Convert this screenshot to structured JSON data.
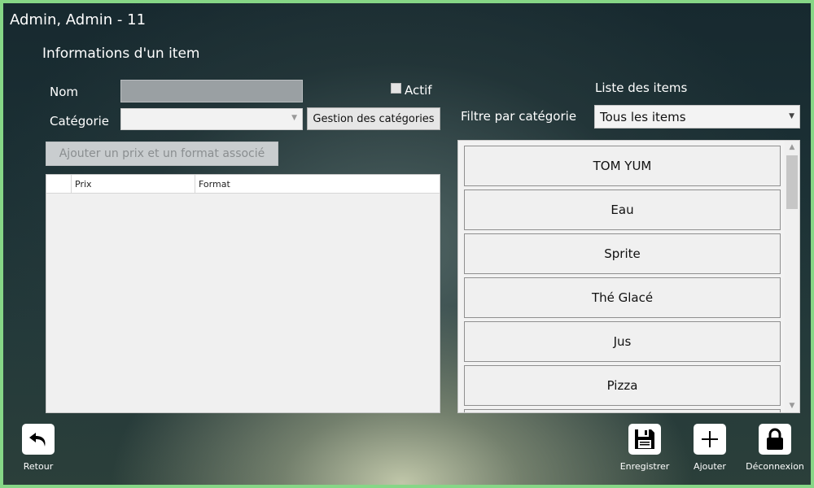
{
  "window": {
    "user_title": "Admin, Admin - 11"
  },
  "form": {
    "section_title": "Informations d'un item",
    "name_label": "Nom",
    "name_value": "",
    "active_label": "Actif",
    "active_checked": false,
    "category_label": "Catégorie",
    "category_value": "",
    "manage_categories_label": "Gestion des catégories",
    "add_price_label": "Ajouter un prix et un format associé",
    "grid_columns": [
      "Prix",
      "Format"
    ]
  },
  "items_list": {
    "title": "Liste des items",
    "filter_label": "Filtre par catégorie",
    "filter_value": "Tous les items",
    "items": [
      "TOM YUM",
      "Eau",
      "Sprite",
      "Thé Glacé",
      "Jus",
      "Pizza"
    ]
  },
  "toolbar": {
    "back_label": "Retour",
    "save_label": "Enregistrer",
    "add_label": "Ajouter",
    "logout_label": "Déconnexion"
  },
  "icons": {
    "back": "undo-arrow-icon",
    "save": "floppy-disk-icon",
    "add": "plus-icon",
    "logout": "padlock-icon"
  }
}
